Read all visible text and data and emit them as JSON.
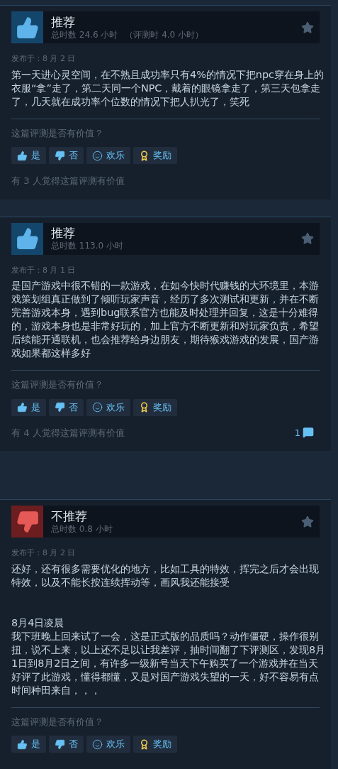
{
  "reviews": [
    {
      "recommended": true,
      "verdict": "推荐",
      "playtime": "总时数 24.6 小时",
      "playtime_at_review": "（评测时 4.0 小时）",
      "posted": "发布于：8 月 2 日",
      "body": [
        [
          "第一天进心灵空间，在不熟且成功率只有4%的情况下把npc穿在身上的衣服“拿”走了，第二天同一个NPC，戴着的眼镜拿走了，第三天包拿走了，几天就在成功率个位数的情况下把人扒光了，笑死"
        ]
      ],
      "question": "这篇评测是否有价值？",
      "buttons": [
        {
          "kind": "yes",
          "label": "是"
        },
        {
          "kind": "no",
          "label": "否"
        },
        {
          "kind": "funny",
          "label": "欢乐"
        },
        {
          "kind": "award",
          "label": "奖励"
        }
      ],
      "helpful": "有 3 人觉得这篇评测有价值"
    },
    {
      "recommended": true,
      "verdict": "推荐",
      "playtime": "总时数 113.0 小时",
      "posted": "发布于：8 月 1 日",
      "body": [
        [
          "是国产游戏中很不错的一款游戏，在如今快时代赚钱的大环境里，本游戏策划组真正做到了倾听玩家声音，经历了多次测试和更新，并在不断完善游戏本身，遇到bug联系官方也能及时处理并回复，这是十分难得的，游戏本身也是非常好玩的，加上官方不断更新和对玩家负责，希望后续能开通联机，也会推荐给身边朋友，期待猴戏游戏的发展，国产游戏如果都这样多好"
        ]
      ],
      "question": "这篇评测是否有价值？",
      "buttons": [
        {
          "kind": "yes",
          "label": "是"
        },
        {
          "kind": "no",
          "label": "否"
        },
        {
          "kind": "funny",
          "label": "欢乐"
        },
        {
          "kind": "award",
          "label": "奖励"
        }
      ],
      "helpful": "有 4 人觉得这篇评测有价值",
      "comments": "1"
    },
    {
      "recommended": false,
      "verdict": "不推荐",
      "playtime": "总时数 0.8 小时",
      "posted": "发布于：8 月 2 日",
      "body": [
        [
          "还好，还有很多需要优化的地方，比如工具的特效，挥完之后才会出现特效，以及不能长按连续挥动等，画风我还能接受"
        ],
        [
          "8月4日凌晨",
          "我下班晚上回来试了一会，这是正式版的品质吗？动作僵硬，操作很别扭，说不上来，以上还不足以让我差评，抽时间翻了下评测区，发现8月1日到8月2日之间，有许多一级新号当天下午购买了一个游戏并在当天好评了此游戏，懂得都懂，又是对国产游戏失望的一天，好不容易有点时间种田来自，，，"
        ]
      ],
      "question": "这篇评测是否有价值？",
      "buttons": [
        {
          "kind": "yes",
          "label": "是"
        },
        {
          "kind": "no",
          "label": "否"
        },
        {
          "kind": "funny",
          "label": "欢乐"
        },
        {
          "kind": "award",
          "label": "奖励"
        }
      ]
    }
  ]
}
